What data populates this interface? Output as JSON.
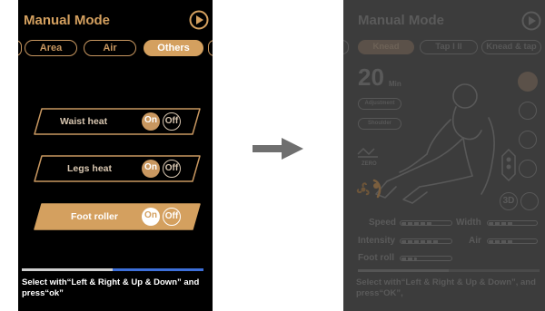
{
  "left": {
    "title": "Manual Mode",
    "tabs": [
      "Area",
      "Air",
      "Others"
    ],
    "active_tab": "Others",
    "rows": [
      {
        "label": "Waist heat",
        "on": "On",
        "off": "Off",
        "active": false
      },
      {
        "label": "Legs heat",
        "on": "On",
        "off": "Off",
        "active": false
      },
      {
        "label": "Foot roller",
        "on": "On",
        "off": "Off",
        "active": true
      }
    ],
    "instruction": "Select with“Left & Right & Up & Down” and press“ok”",
    "progress": 0.5
  },
  "arrow": "right-arrow",
  "right": {
    "title": "Manual Mode",
    "tabs": [
      "Knead",
      "Tap I II",
      "Knead & tap"
    ],
    "active_tab": "Knead",
    "time_value": "20",
    "time_unit": "Min",
    "buttons": [
      "Adjustment",
      "Shoulder"
    ],
    "zero_label": "ZERO",
    "three_d": "3D",
    "params": [
      {
        "label": "Speed",
        "level": 0.6
      },
      {
        "label": "Width",
        "level": 0.5
      },
      {
        "label": "Intensity",
        "level": 0.75
      },
      {
        "label": "Air",
        "level": 0.5
      },
      {
        "label": "Foot roll",
        "level": 0.3
      }
    ],
    "instruction": "Select with“Left & Right & Up & Down”, and press“OK”,",
    "progress": 0.5
  }
}
